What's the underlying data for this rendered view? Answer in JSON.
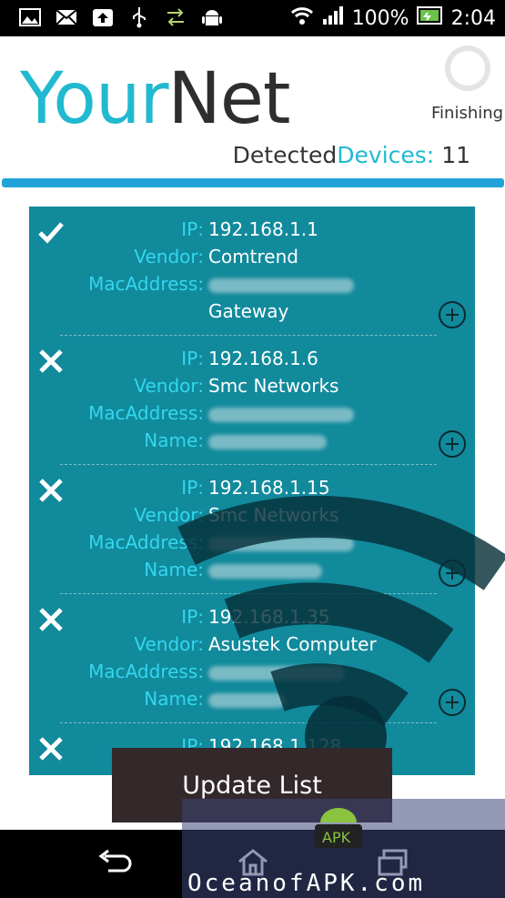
{
  "status_bar": {
    "battery": "100%",
    "time": "2:04",
    "left_icons": [
      "image-icon",
      "mail-icon",
      "upload-icon",
      "usb-icon",
      "sync-icon",
      "android-icon"
    ]
  },
  "header": {
    "logo_part1": "Your",
    "logo_part2": "Net",
    "status": "Finishing",
    "detected_prefix": "Detected",
    "detected_label": "Devices:",
    "detected_count": "11"
  },
  "devices": [
    {
      "status_icon": "check-icon",
      "ip_label": "IP:",
      "ip": "192.168.1.1",
      "vendor_label": "Vendor:",
      "vendor": "Comtrend",
      "mac_label": "MacAddress:",
      "extra": "Gateway"
    },
    {
      "status_icon": "x-icon",
      "ip_label": "IP:",
      "ip": "192.168.1.6",
      "vendor_label": "Vendor:",
      "vendor": "Smc Networks",
      "mac_label": "MacAddress:",
      "name_label": "Name:"
    },
    {
      "status_icon": "x-icon",
      "ip_label": "IP:",
      "ip": "192.168.1.15",
      "vendor_label": "Vendor:",
      "vendor": "Smc Networks",
      "mac_label": "MacAddress:",
      "name_label": "Name:"
    },
    {
      "status_icon": "x-icon",
      "ip_label": "IP:",
      "ip": "192.168.1.35",
      "vendor_label": "Vendor:",
      "vendor": "Asustek Computer",
      "mac_label": "MacAddress:",
      "name_label": "Name:"
    },
    {
      "status_icon": "x-icon",
      "ip_label": "IP:",
      "ip": "192.168.1.128"
    }
  ],
  "update_button": "Update List",
  "watermark": "OceanofAPK.com",
  "colors": {
    "accent": "#21b9d0",
    "panel": "#118a9c",
    "button": "#33292a"
  }
}
